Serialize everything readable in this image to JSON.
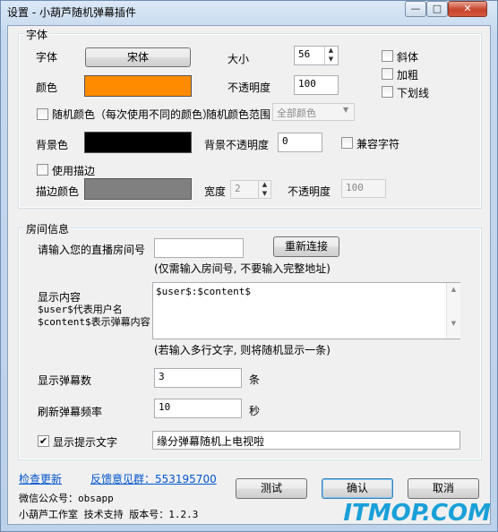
{
  "window": {
    "title": "设置 - 小葫芦随机弹幕插件",
    "minimize": "—",
    "maximize": "□",
    "close": "✕"
  },
  "font_group": {
    "legend": "字体",
    "font_label": "字体",
    "font_button": "宋体",
    "size_label": "大小",
    "size_value": "56",
    "italic": "斜体",
    "bold": "加粗",
    "underline": "下划线",
    "color_label": "颜色",
    "color_swatch": "#ff8c00",
    "opacity_label": "不透明度",
    "opacity_value": "100",
    "random_color": "随机颜色（每次使用不同的颜色）",
    "random_range_label": "随机颜色范围",
    "random_range_value": "全部颜色",
    "bg_label": "背景色",
    "bg_swatch": "#000000",
    "bg_opacity_label": "背景不透明度",
    "bg_opacity_value": "0",
    "compat": "兼容字符",
    "use_outline": "使用描边",
    "outline_color_label": "描边颜色",
    "outline_swatch": "#808080",
    "width_label": "宽度",
    "width_value": "2",
    "outline_opacity_label": "不透明度",
    "outline_opacity_value": "100"
  },
  "room_group": {
    "legend": "房间信息",
    "room_label": "请输入您的直播房间号",
    "room_value": "",
    "reconnect": "重新连接",
    "room_hint": "(仅需输入房间号, 不要输入完整地址)",
    "content_label_1": "显示内容",
    "content_label_2": "$user$代表用户名",
    "content_label_3": "$content$表示弹幕内容",
    "content_value": "$user$:$content$",
    "content_hint": "(若输入多行文字, 则将随机显示一条)",
    "count_label": "显示弹幕数",
    "count_value": "3",
    "count_unit": "条",
    "freq_label": "刷新弹幕频率",
    "freq_value": "10",
    "freq_unit": "秒",
    "show_tip": "显示提示文字",
    "tip_value": "缘分弹幕随机上电视啦"
  },
  "footer": {
    "check_update": "检查更新",
    "feedback": "反馈意见群：553195700",
    "wechat": "微信公众号：obsapp",
    "studio": "小葫芦工作室  技术支持  版本号：1.2.3",
    "test": "测试",
    "ok": "确认",
    "cancel": "取消"
  },
  "watermark": "ITMOP.COM"
}
